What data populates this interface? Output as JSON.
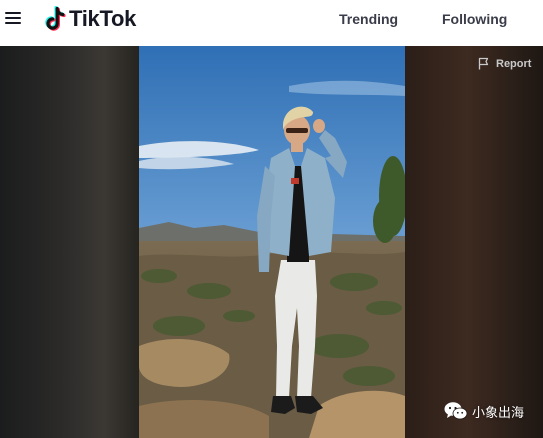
{
  "app": {
    "name": "TikTok"
  },
  "nav": {
    "trending": "Trending",
    "following": "Following"
  },
  "icons": {
    "menu": "hamburger-menu-icon",
    "logo": "tiktok-note-icon",
    "report": "flag-icon",
    "watermark": "wechat-icon"
  },
  "player": {
    "report_label": "Report"
  },
  "watermark": {
    "text": "小象出海"
  },
  "colors": {
    "brand_text": "#161823",
    "nav_text": "#3a3d49",
    "logo_cyan": "#25f4ee",
    "logo_red": "#fe2c55"
  }
}
